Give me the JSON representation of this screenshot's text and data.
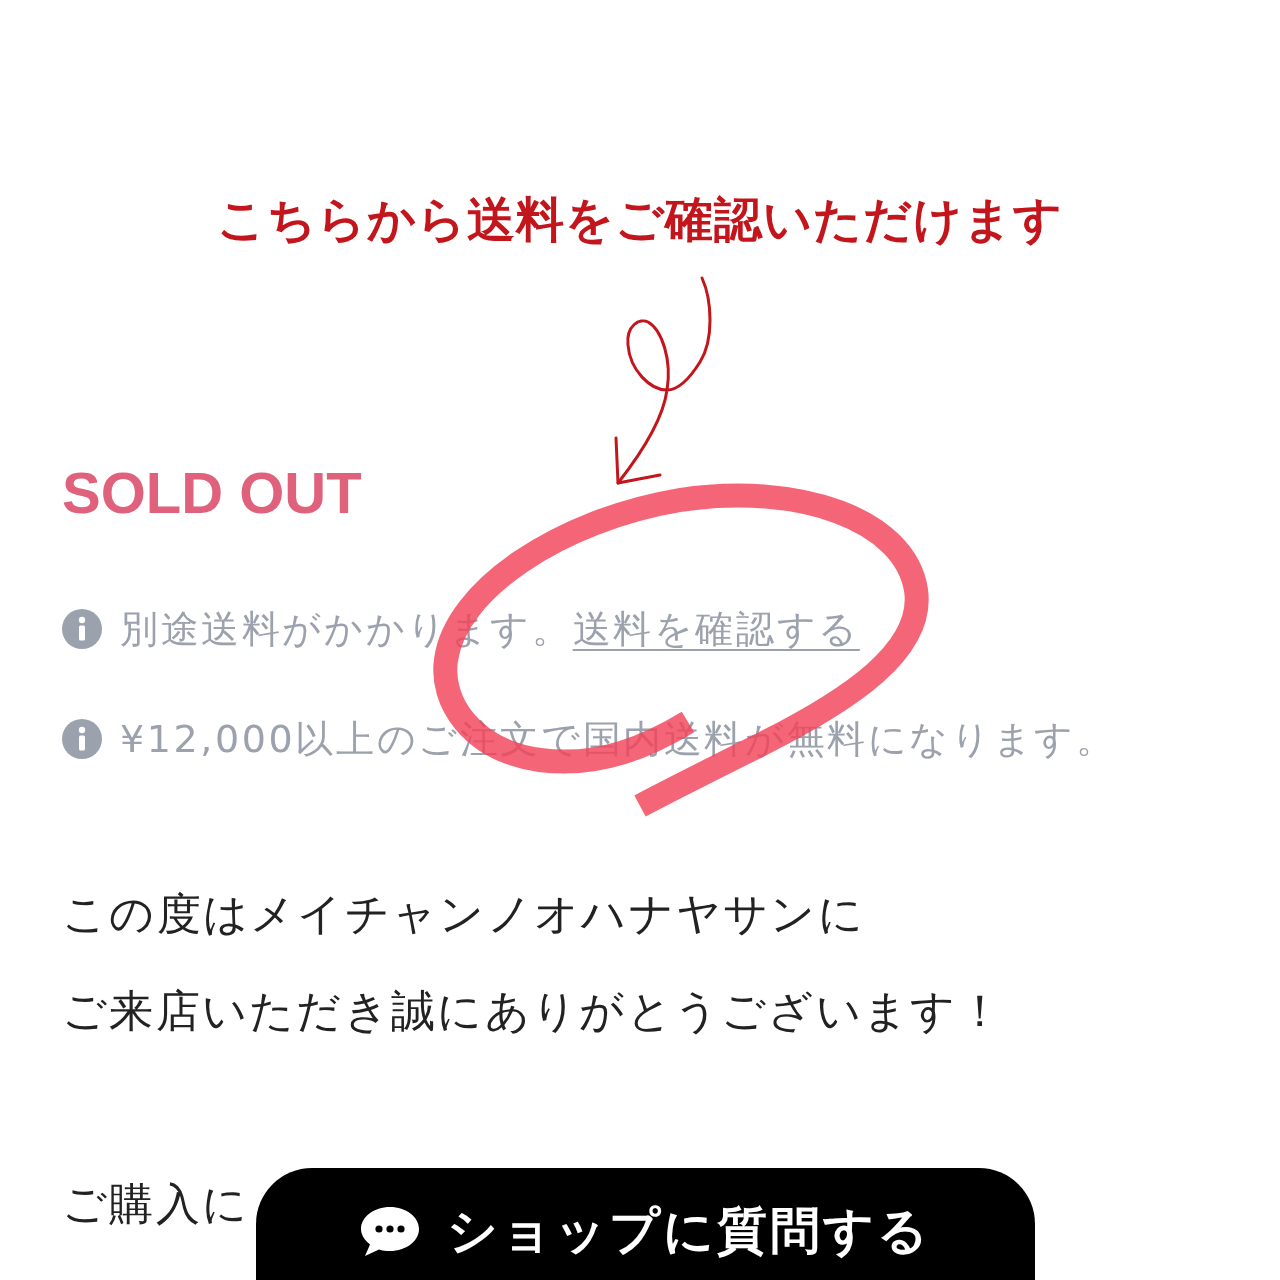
{
  "annotation": {
    "caption": "こちらから送料をご確認いただけます"
  },
  "product": {
    "status": "SOLD OUT",
    "notices": [
      {
        "text": "別途送料がかかります。",
        "link": "送料を確認する"
      },
      {
        "text": "¥12,000以上のご注文で国内送料が無料になります。"
      }
    ],
    "description": [
      [
        "この度はメイチャンノオハナヤサンに",
        "ご来店いただき誠にありがとうございます！"
      ],
      [
        "ご購入に"
      ]
    ]
  },
  "chat_button": {
    "label": "ショップに質問する"
  }
}
